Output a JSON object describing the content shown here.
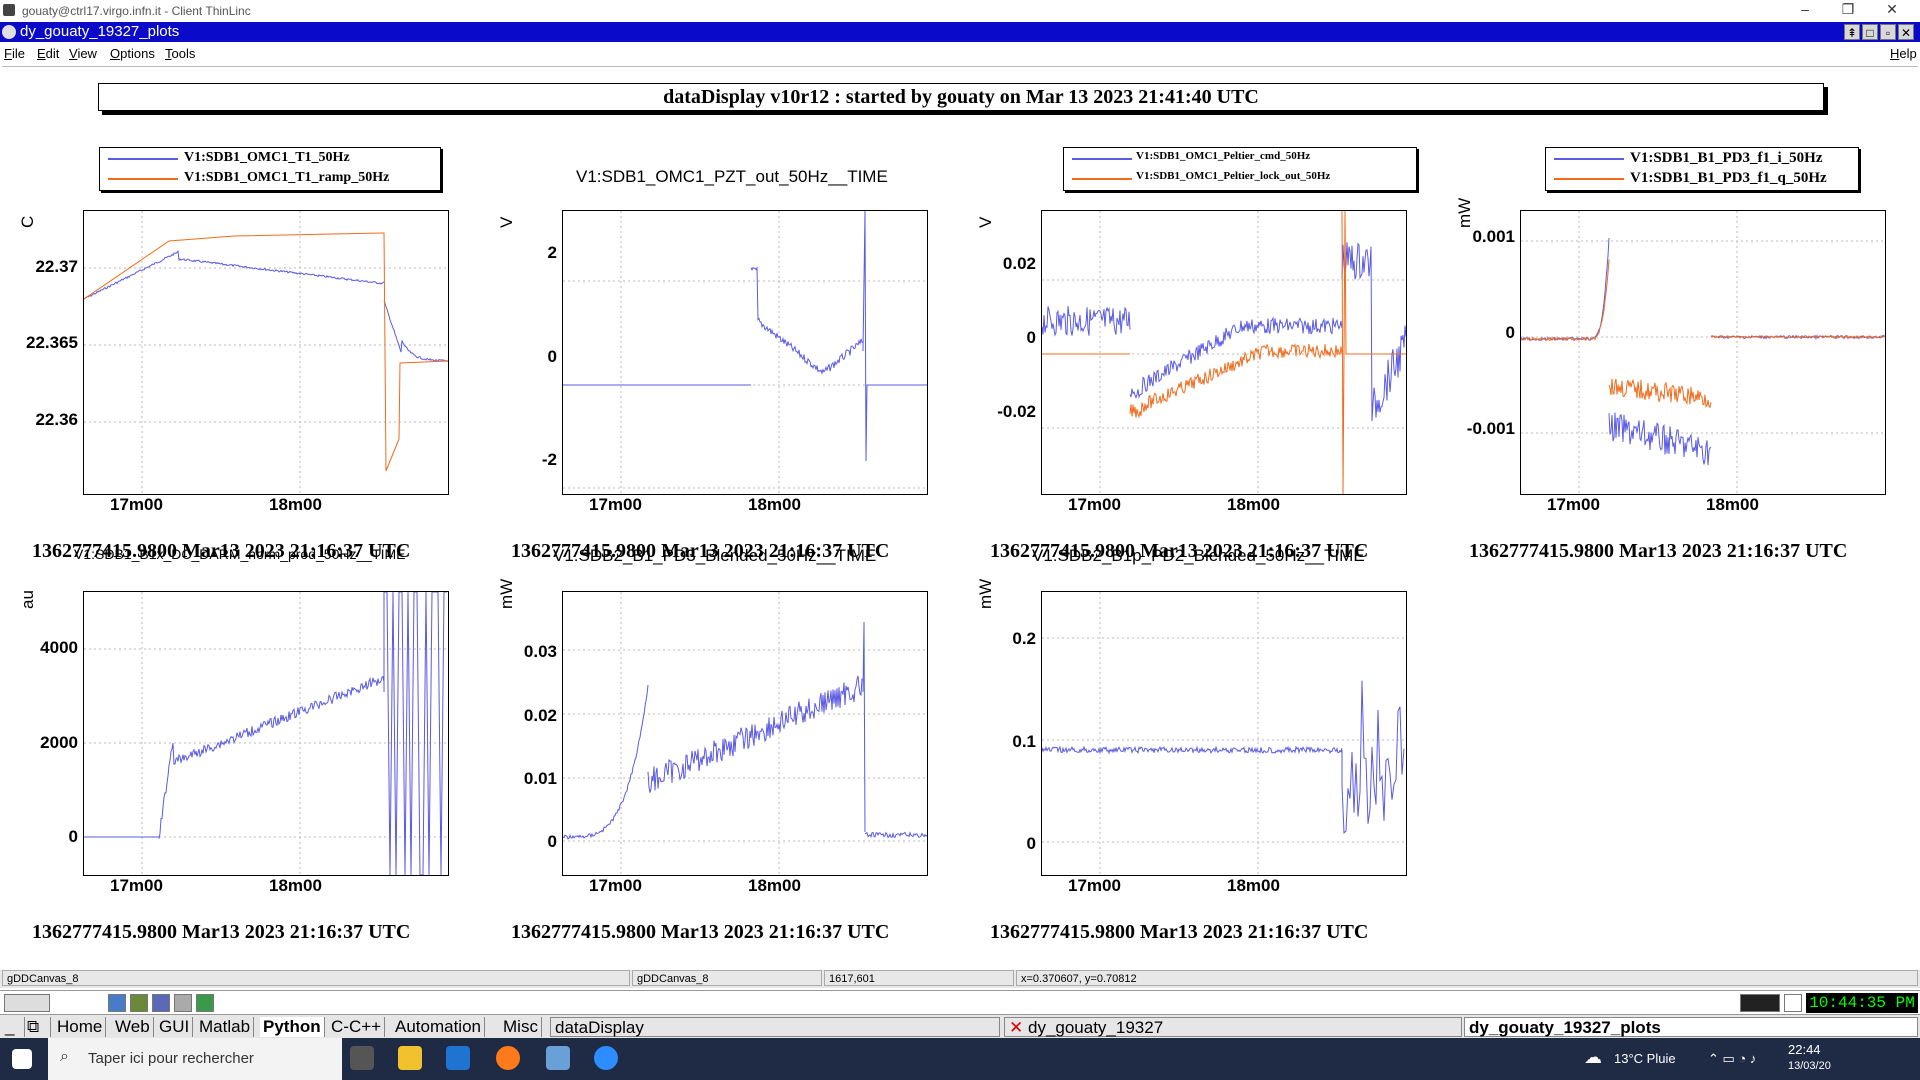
{
  "thinlinc": {
    "title": "gouaty@ctrl17.virgo.infn.it - Client ThinLinc"
  },
  "window": {
    "title": "dy_gouaty_19327_plots"
  },
  "menu": {
    "file": "File",
    "edit": "Edit",
    "view": "View",
    "options": "Options",
    "tools": "Tools",
    "help": "Help"
  },
  "header": "dataDisplay v10r12 : started by gouaty on Mar 13 2023 21:41:40 UTC",
  "timestamp": "1362777415.9800 Mar13 2023 21:16:37 UTC",
  "x_ticks": [
    "17m00",
    "18m00"
  ],
  "colors": {
    "blue": "#5a5ae6",
    "orange": "#f26b1d",
    "panel_blue": "#0a0ac8"
  },
  "plots": [
    {
      "title": "",
      "ylabel": "C",
      "yticks": [
        "22.37",
        "22.365",
        "22.36"
      ],
      "legend": [
        "V1:SDB1_OMC1_T1_50Hz",
        "V1:SDB1_OMC1_T1_ramp_50Hz"
      ]
    },
    {
      "title": "V1:SDB1_OMC1_PZT_out_50Hz__TIME",
      "ylabel": "V",
      "yticks": [
        "2",
        "0",
        "-2"
      ],
      "legend": []
    },
    {
      "title": "",
      "ylabel": "V",
      "yticks": [
        "0.02",
        "0",
        "-0.02"
      ],
      "legend": [
        "V1:SDB1_OMC1_Peltier_cmd_50Hz",
        "V1:SDB1_OMC1_Peltier_lock_out_50Hz"
      ]
    },
    {
      "title": "",
      "ylabel": "mW",
      "yticks": [
        "0.001",
        "0",
        "-0.001"
      ],
      "legend": [
        "V1:SDB1_B1_PD3_f1_i_50Hz",
        "V1:SDB1_B1_PD3_f1_q_50Hz"
      ]
    },
    {
      "title": "V1:SDB1_B1x_DC_DARM_norm_prod_50Hz__TIME",
      "ylabel": "au",
      "yticks": [
        "4000",
        "2000",
        "0"
      ],
      "legend": []
    },
    {
      "title": "V1:SDB2_B1_PD3_Blended_50Hz__TIME",
      "ylabel": "mW",
      "yticks": [
        "0.03",
        "0.02",
        "0.01",
        "0"
      ],
      "legend": []
    },
    {
      "title": "V1:SDB2_B1p_PD2_Blended_50Hz__TIME",
      "ylabel": "mW",
      "yticks": [
        "0.2",
        "0.1",
        "0"
      ],
      "legend": []
    }
  ],
  "status": {
    "canvas1": "gDDCanvas_8",
    "canvas2": "gDDCanvas_8",
    "coords": "1617,601",
    "xy": "x=0.370607, y=0.70812"
  },
  "panel": {
    "clock": "10:44:35 PM",
    "tabs": [
      "Home",
      "Web",
      "GUI",
      "Matlab",
      "Python",
      "C-C++",
      "Automation",
      "Misc"
    ],
    "tasks": [
      "dataDisplay",
      "dy_gouaty_19327",
      "dy_gouaty_19327_plots"
    ]
  },
  "taskbar": {
    "search": "Taper ici pour rechercher",
    "weather": "13°C  Pluie",
    "time": "22:44",
    "date": "13/03/20"
  }
}
